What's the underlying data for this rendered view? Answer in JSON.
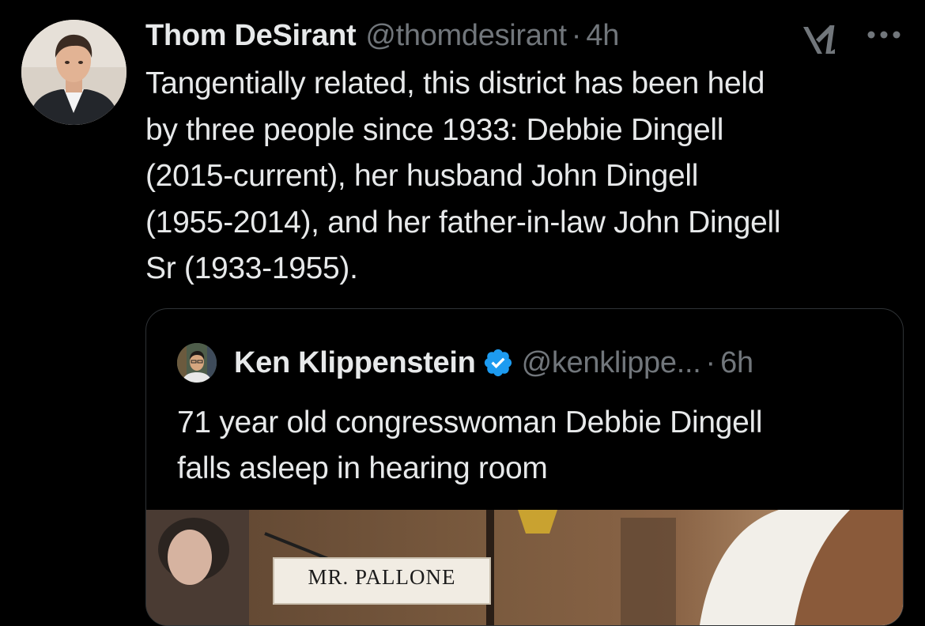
{
  "tweet": {
    "author": {
      "display_name": "Thom DeSirant",
      "handle": "@thomdesirant",
      "separator": "·",
      "time": "4h",
      "avatar_icon": "profile-photo-man-in-suit"
    },
    "grok_icon": "grok-icon",
    "more_icon": "more-horizontal-icon",
    "text_lines": [
      "Tangentially related, this district has been held",
      "by three people since 1933: Debbie Dingell",
      "(2015-current), her husband John Dingell",
      "(1955-2014), and her father-in-law John Dingell",
      "Sr (1933-1955)."
    ],
    "quote": {
      "author": {
        "display_name": "Ken Klippenstein",
        "verified": true,
        "verified_color": "#1d9bf0",
        "handle": "@kenklippe...",
        "separator": "·",
        "time": "6h"
      },
      "text_lines": [
        "71 year old congresswoman Debbie Dingell",
        "falls asleep in hearing room"
      ],
      "media": {
        "nameplate_text": "MR. PALLONE"
      }
    }
  },
  "colors": {
    "background": "#000000",
    "primary_text": "#e7e9ea",
    "secondary_text": "#71767b",
    "border": "#2f3336",
    "verified_blue": "#1d9bf0"
  }
}
